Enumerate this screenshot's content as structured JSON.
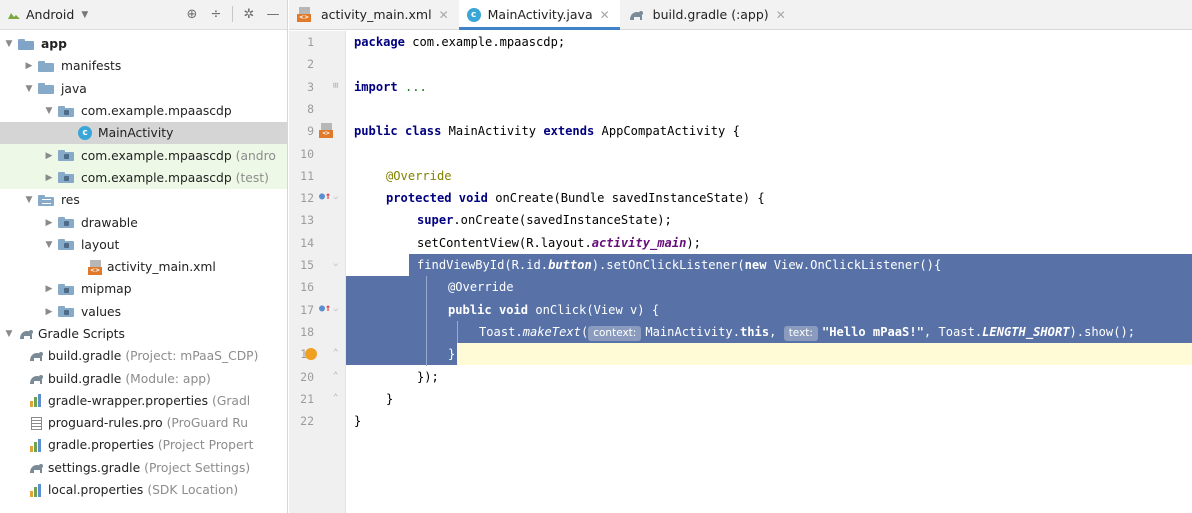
{
  "project_panel": {
    "view_label": "Android",
    "tree": [
      {
        "label": "app",
        "bold": true
      },
      {
        "label": "manifests"
      },
      {
        "label": "java"
      },
      {
        "label": "com.example.mpaascdp"
      },
      {
        "label": "MainActivity"
      },
      {
        "label": "com.example.mpaascdp",
        "hint": "(andro"
      },
      {
        "label": "com.example.mpaascdp",
        "hint": "(test)"
      },
      {
        "label": "res"
      },
      {
        "label": "drawable"
      },
      {
        "label": "layout"
      },
      {
        "label": "activity_main.xml"
      },
      {
        "label": "mipmap"
      },
      {
        "label": "values"
      },
      {
        "label": "Gradle Scripts"
      },
      {
        "label": "build.gradle",
        "hint": "(Project: mPaaS_CDP)"
      },
      {
        "label": "build.gradle",
        "hint": "(Module: app)"
      },
      {
        "label": "gradle-wrapper.properties",
        "hint": "(Gradl"
      },
      {
        "label": "proguard-rules.pro",
        "hint": "(ProGuard Ru"
      },
      {
        "label": "gradle.properties",
        "hint": "(Project Propert"
      },
      {
        "label": "settings.gradle",
        "hint": "(Project Settings)"
      },
      {
        "label": "local.properties",
        "hint": "(SDK Location)"
      }
    ]
  },
  "tabs": [
    {
      "label": "activity_main.xml",
      "active": false
    },
    {
      "label": "MainActivity.java",
      "active": true
    },
    {
      "label": "build.gradle (:app)",
      "active": false
    }
  ],
  "editor": {
    "line_numbers": [
      "1",
      "2",
      "3",
      "8",
      "9",
      "10",
      "11",
      "12",
      "13",
      "14",
      "15",
      "16",
      "17",
      "18",
      "19",
      "20",
      "21",
      "22"
    ],
    "hints": {
      "context": "context:",
      "text": "text:"
    },
    "code": {
      "l1_kw": "package",
      "l1_rest": " com.example.mpaascdp;",
      "l3_kw": "import",
      "l3_rest": " ...",
      "l9_kw1": "public class",
      "l9_mid": " MainActivity ",
      "l9_kw2": "extends",
      "l9_rest": " AppCompatActivity {",
      "l11_ann": "@Override",
      "l12_kw": "protected void",
      "l12_rest": " onCreate(Bundle savedInstanceState) {",
      "l13_kw": "super",
      "l13_rest": ".onCreate(savedInstanceState);",
      "l14_a": "setContentView(R.layout.",
      "l14_f": "activity_main",
      "l14_b": ");",
      "l15_a": "findViewById(R.id.",
      "l15_f": "button",
      "l15_b": ").setOnClickListener(",
      "l15_kw": "new",
      "l15_c": " View.OnClickListener(){",
      "l16_ann": "@Override",
      "l17_kw": "public void",
      "l17_rest": " onClick(View v) {",
      "l18_a": "Toast.",
      "l18_m": "makeText",
      "l18_b": "(",
      "l18_c": "MainActivity.",
      "l18_kw": "this",
      "l18_d": ", ",
      "l18_str": "\"Hello mPaaS!\"",
      "l18_e": ", Toast.",
      "l18_f": "LENGTH_SHORT",
      "l18_g": ").show();",
      "l19": "}",
      "l20": "});",
      "l21": "}",
      "l22": "}"
    }
  }
}
